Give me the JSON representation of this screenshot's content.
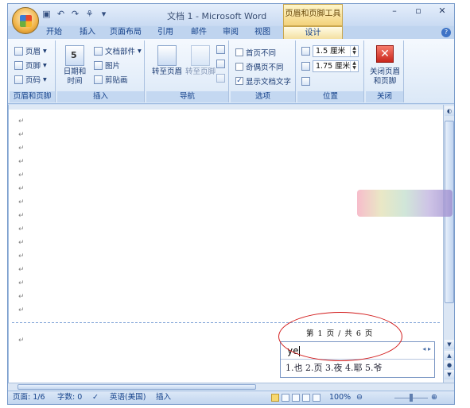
{
  "title_bar": {
    "app_title": "文档 1 - Microsoft Word",
    "context_tool_title": "页眉和页脚工具",
    "min": "–",
    "max": "▫",
    "close": "✕"
  },
  "tabs": [
    "开始",
    "插入",
    "页面布局",
    "引用",
    "邮件",
    "审阅",
    "视图",
    "设计"
  ],
  "active_tab": "设计",
  "ribbon": {
    "hf_group": {
      "header": "页眉",
      "footer": "页脚",
      "page_number": "页码",
      "label": "页眉和页脚"
    },
    "insert_group": {
      "date_time": "日期和\n时间",
      "doc_parts": "文档部件",
      "picture": "图片",
      "clipart": "剪贴画",
      "label": "插入"
    },
    "nav_group": {
      "goto_header": "转至页眉",
      "goto_footer": "转至页脚",
      "label": "导航"
    },
    "options_group": {
      "first_page": "首页不同",
      "odd_even": "奇偶页不同",
      "show_text": "显示文档文字",
      "first_page_checked": false,
      "odd_even_checked": false,
      "show_text_checked": true,
      "label": "选项"
    },
    "position_group": {
      "top_value": "1.5 厘米",
      "bottom_value": "1.75 厘米",
      "label": "位置"
    },
    "close_group": {
      "close_label": "关闭页眉\n和页脚",
      "label": "关闭"
    }
  },
  "document": {
    "paragraph_mark": "↵",
    "footer_text": "第 1 页 / 共 6 页"
  },
  "ime": {
    "input": "ye",
    "candidates": "1.也 2.页 3.夜 4.耶 5.爷",
    "nav": "◂ ▸"
  },
  "status_bar": {
    "page": "页面: 1/6",
    "words": "字数: 0",
    "language": "英语(美国)",
    "mode": "插入",
    "zoom": "100%"
  }
}
